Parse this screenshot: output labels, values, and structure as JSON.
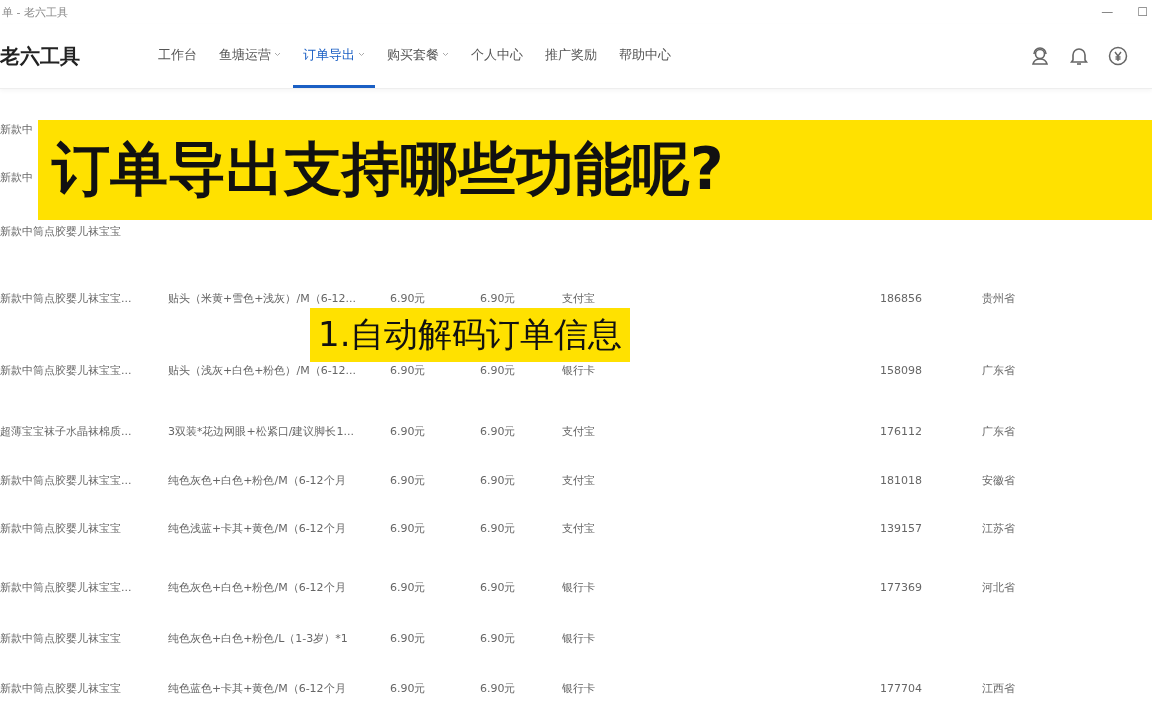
{
  "window": {
    "title": "单 - 老六工具",
    "controls": [
      "—",
      "☐"
    ]
  },
  "app": {
    "logo": "老六工具"
  },
  "nav": [
    {
      "label": "工作台",
      "dropdown": false,
      "selected": false
    },
    {
      "label": "鱼塘运营",
      "dropdown": true,
      "selected": false
    },
    {
      "label": "订单导出",
      "dropdown": true,
      "selected": true
    },
    {
      "label": "购买套餐",
      "dropdown": true,
      "selected": false
    },
    {
      "label": "个人中心",
      "dropdown": false,
      "selected": false
    },
    {
      "label": "推广奖励",
      "dropdown": false,
      "selected": false
    },
    {
      "label": "帮助中心",
      "dropdown": false,
      "selected": false
    }
  ],
  "table": {
    "rows": [
      {
        "product": "新款中"
      },
      {
        "product": "新款中"
      },
      {
        "product": "新款中筒点胶婴儿袜宝宝"
      },
      {
        "product": "新款中筒点胶婴儿袜宝宝...",
        "sku": "贴头（米黄+雪色+浅灰）/M（6-12...",
        "price": "6.90元",
        "paid": "6.90元",
        "payment": "支付宝",
        "phone": "186856",
        "province": "贵州省"
      },
      {
        "product": "新款中筒点胶婴儿袜宝宝...",
        "sku": "贴头（浅灰+白色+粉色）/M（6-12...",
        "price": "6.90元",
        "paid": "6.90元",
        "payment": "银行卡",
        "phone": "158098",
        "province": "广东省"
      },
      {
        "product": "超薄宝宝袜子水晶袜棉质...",
        "sku": "3双装*花边网眼+松紧口/建议脚长1...",
        "price": "6.90元",
        "paid": "6.90元",
        "payment": "支付宝",
        "phone": "176112",
        "province": "广东省"
      },
      {
        "product": "新款中筒点胶婴儿袜宝宝...",
        "sku": "纯色灰色+白色+粉色/M（6-12个月",
        "price": "6.90元",
        "paid": "6.90元",
        "payment": "支付宝",
        "phone": "181018",
        "province": "安徽省"
      },
      {
        "product": "新款中筒点胶婴儿袜宝宝",
        "sku": "纯色浅蓝+卡其+黄色/M（6-12个月",
        "price": "6.90元",
        "paid": "6.90元",
        "payment": "支付宝",
        "phone": "139157",
        "province": "江苏省"
      },
      {
        "product": "新款中筒点胶婴儿袜宝宝...",
        "sku": "纯色灰色+白色+粉色/M（6-12个月",
        "price": "6.90元",
        "paid": "6.90元",
        "payment": "银行卡",
        "phone": "177369",
        "province": "河北省"
      },
      {
        "product": "新款中筒点胶婴儿袜宝宝",
        "sku": "纯色灰色+白色+粉色/L（1-3岁）*1",
        "price": "6.90元",
        "paid": "6.90元",
        "payment": "银行卡"
      },
      {
        "product": "新款中筒点胶婴儿袜宝宝",
        "sku": "纯色蓝色+卡其+黄色/M（6-12个月",
        "price": "6.90元",
        "paid": "6.90元",
        "payment": "银行卡",
        "phone": "177704",
        "province": "江西省"
      }
    ]
  },
  "captions": [
    {
      "kind": "headline",
      "text": "订单导出支持哪些功能呢?"
    },
    {
      "kind": "point",
      "text": "1.自动解码订单信息"
    }
  ]
}
